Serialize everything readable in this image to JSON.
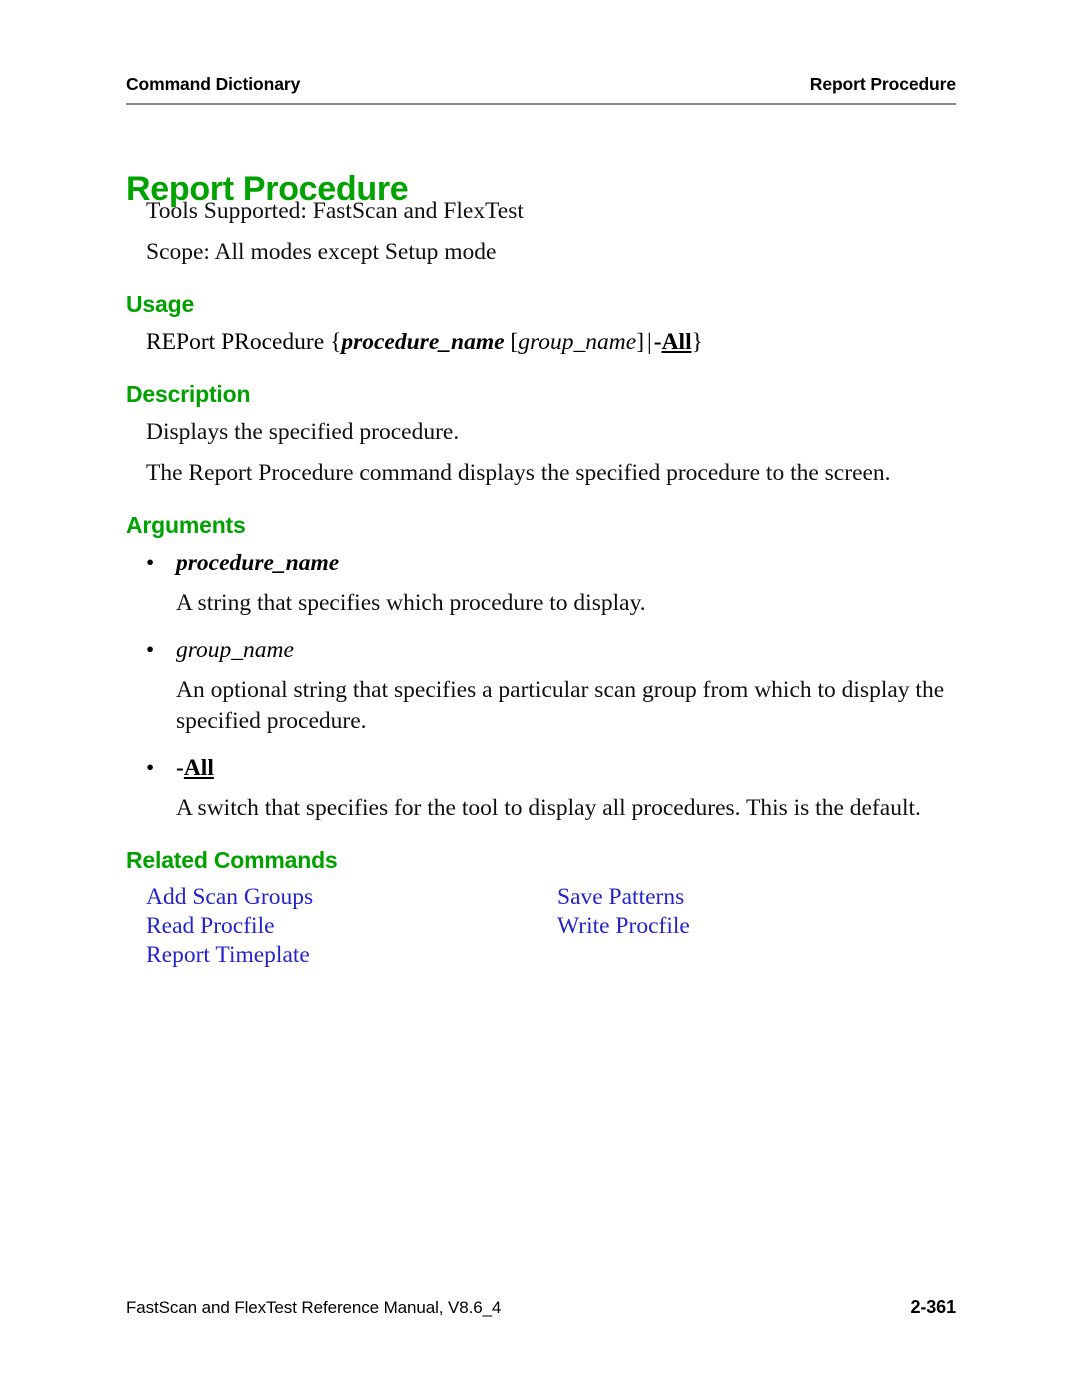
{
  "header": {
    "left": "Command Dictionary",
    "right": "Report Procedure"
  },
  "title": "Report Procedure",
  "intro": {
    "tools_supported": "Tools Supported: FastScan and FlexTest",
    "scope": "Scope: All modes except Setup mode"
  },
  "sections": {
    "usage_heading": "Usage",
    "description_heading": "Description",
    "arguments_heading": "Arguments",
    "related_heading": "Related Commands"
  },
  "usage": {
    "command": "REPort PRocedure",
    "open_brace": "{",
    "arg1": "procedure_name",
    "arg2_open": "[",
    "arg2": "group_name",
    "arg2_close": "]",
    "separator": "|",
    "switch_dash": "-",
    "switch_name": "All",
    "close_brace": "}"
  },
  "description": {
    "line1": "Displays the specified procedure.",
    "line2": "The Report Procedure command displays the specified procedure to the screen."
  },
  "arguments": [
    {
      "bullet": "•",
      "name": "procedure_name",
      "style": "bold-italic",
      "desc": "A string that specifies which procedure to display."
    },
    {
      "bullet": "•",
      "name": "group_name",
      "style": "italic",
      "desc": "An optional string that specifies a particular scan group from which to display the specified procedure."
    },
    {
      "bullet": "•",
      "name_dash": "-",
      "name": "All",
      "style": "bold-underline",
      "desc": "A switch that specifies for the tool to display all procedures. This is the default."
    }
  ],
  "related_commands": {
    "left_column": [
      "Add Scan Groups",
      "Read Procfile",
      "Report Timeplate"
    ],
    "right_column": [
      "Save Patterns",
      "Write Procfile"
    ]
  },
  "footer": {
    "manual": "FastScan and FlexTest Reference Manual, V8.6_4",
    "page": "2-361"
  },
  "colors": {
    "heading_green": "#00a200",
    "link_blue": "#2323cc",
    "rule_gray": "#8a8a8a",
    "text_black": "#100f0f"
  }
}
